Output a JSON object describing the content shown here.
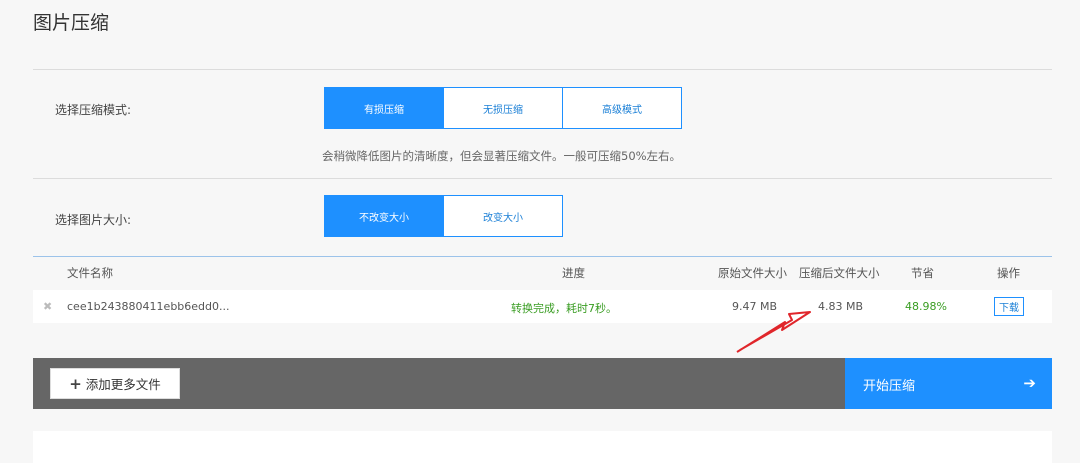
{
  "page": {
    "title": "图片压缩"
  },
  "mode": {
    "label": "选择压缩模式:",
    "options": [
      "有损压缩",
      "无损压缩",
      "高级模式"
    ],
    "selected": "有损压缩",
    "hint": "会稍微降低图片的清晰度，但会显著压缩文件。一般可压缩50%左右。"
  },
  "size": {
    "label": "选择图片大小:",
    "options": [
      "不改变大小",
      "改变大小"
    ],
    "selected": "不改变大小"
  },
  "table": {
    "headers": {
      "name": "文件名称",
      "progress": "进度",
      "original": "原始文件大小",
      "compressed": "压缩后文件大小",
      "saved": "节省",
      "action": "操作"
    },
    "rows": [
      {
        "remove": "✖",
        "name": "cee1b243880411ebb6edd0...",
        "progress": "转换完成，耗时7秒。",
        "original": "9.47 MB",
        "compressed": "4.83 MB",
        "saved": "48.98%",
        "action": "下载"
      }
    ]
  },
  "actions": {
    "add_more": "添加更多文件",
    "add_icon": "plus-icon",
    "start": "开始压缩",
    "start_icon": "arrow-right-icon"
  },
  "colors": {
    "accent": "#1e90ff",
    "bar": "#666666",
    "success": "#3a9d23",
    "annotation": "#e0262b"
  }
}
